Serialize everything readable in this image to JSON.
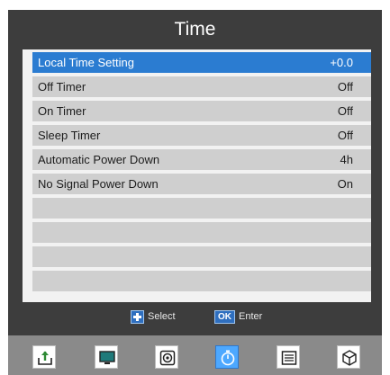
{
  "title": "Time",
  "rows": [
    {
      "label": "Local Time Setting",
      "value": "+0.0"
    },
    {
      "label": "Off Timer",
      "value": "Off"
    },
    {
      "label": "On Timer",
      "value": "Off"
    },
    {
      "label": "Sleep Timer",
      "value": "Off"
    },
    {
      "label": "Automatic Power Down",
      "value": "4h"
    },
    {
      "label": "No Signal Power Down",
      "value": "On"
    }
  ],
  "hints": {
    "select_label": "Select",
    "ok_key": "OK",
    "enter_label": "Enter"
  },
  "menu_icons": [
    "upload-icon",
    "monitor-icon",
    "audio-icon",
    "timer-icon",
    "list-icon",
    "cube-icon"
  ],
  "colors": {
    "background": "#3d3d3d",
    "highlight": "#2b7cd1",
    "row": "#cfcfcf",
    "active_menu": "#4da8ff"
  }
}
